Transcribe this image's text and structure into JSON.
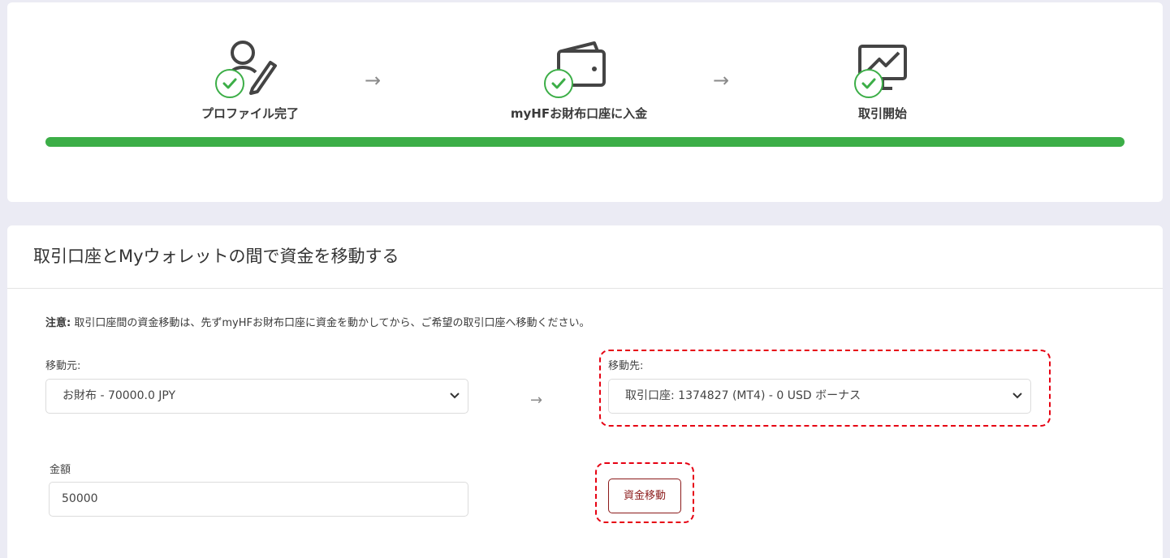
{
  "steps": [
    {
      "label": "プロファイル完了",
      "icon": "user-edit-icon",
      "done": true
    },
    {
      "label": "myHFお財布口座に入金",
      "icon": "wallet-icon",
      "done": true
    },
    {
      "label": "取引開始",
      "icon": "chart-monitor-icon",
      "done": true
    }
  ],
  "step_arrow": "→",
  "progress": {
    "percent": 100,
    "color": "#3cae47"
  },
  "transfer": {
    "title": "取引口座とMyウォレットの間で資金を移動する",
    "notice_label": "注意:",
    "notice_text": " 取引口座間の資金移動は、先ずmyHFお財布口座に資金を動かしてから、ご希望の取引口座へ移動ください。",
    "from_label": "移動元:",
    "from_value": "お財布 - 70000.0 JPY",
    "to_label": "移動先:",
    "to_value": "取引口座: 1374827 (MT4) - 0 USD ボーナス",
    "amount_label": "金額",
    "amount_value": "50000",
    "button_label": "資金移動",
    "arrow": "→"
  },
  "colors": {
    "accent_green": "#3cae47",
    "highlight_red": "#e60012",
    "button_red": "#8b1a1a"
  }
}
